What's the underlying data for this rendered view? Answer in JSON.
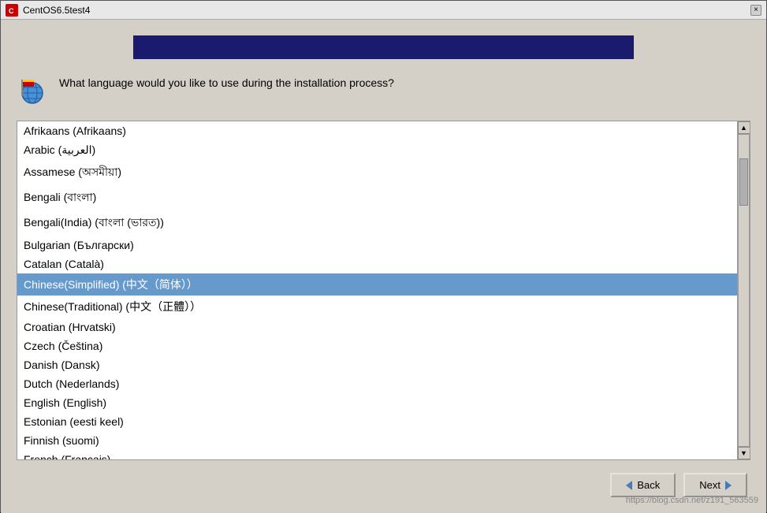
{
  "window": {
    "title": "CentOS6.5test4",
    "close_label": "×"
  },
  "header": {
    "question": "What language would you like to use during the\ninstallation process?"
  },
  "languages": [
    {
      "id": "afrikaans",
      "label": "Afrikaans (Afrikaans)",
      "selected": false
    },
    {
      "id": "arabic",
      "label": "Arabic (العربية)",
      "selected": false
    },
    {
      "id": "assamese",
      "label": "Assamese (অসমীয়া)",
      "selected": false
    },
    {
      "id": "bengali",
      "label": "Bengali (বাংলা)",
      "selected": false
    },
    {
      "id": "bengali-india",
      "label": "Bengali(India) (বাংলা (ভারত))",
      "selected": false
    },
    {
      "id": "bulgarian",
      "label": "Bulgarian (Български)",
      "selected": false
    },
    {
      "id": "catalan",
      "label": "Catalan (Català)",
      "selected": false
    },
    {
      "id": "chinese-simplified",
      "label": "Chinese(Simplified) (中文（简体））",
      "selected": true
    },
    {
      "id": "chinese-traditional",
      "label": "Chinese(Traditional) (中文（正體））",
      "selected": false
    },
    {
      "id": "croatian",
      "label": "Croatian (Hrvatski)",
      "selected": false
    },
    {
      "id": "czech",
      "label": "Czech (Čeština)",
      "selected": false
    },
    {
      "id": "danish",
      "label": "Danish (Dansk)",
      "selected": false
    },
    {
      "id": "dutch",
      "label": "Dutch (Nederlands)",
      "selected": false
    },
    {
      "id": "english",
      "label": "English (English)",
      "selected": false
    },
    {
      "id": "estonian",
      "label": "Estonian (eesti keel)",
      "selected": false
    },
    {
      "id": "finnish",
      "label": "Finnish (suomi)",
      "selected": false
    },
    {
      "id": "french",
      "label": "French (Français)",
      "selected": false
    }
  ],
  "buttons": {
    "back_label": "Back",
    "next_label": "Next"
  },
  "watermark": "https://blog.csdn.net/z191_563559"
}
